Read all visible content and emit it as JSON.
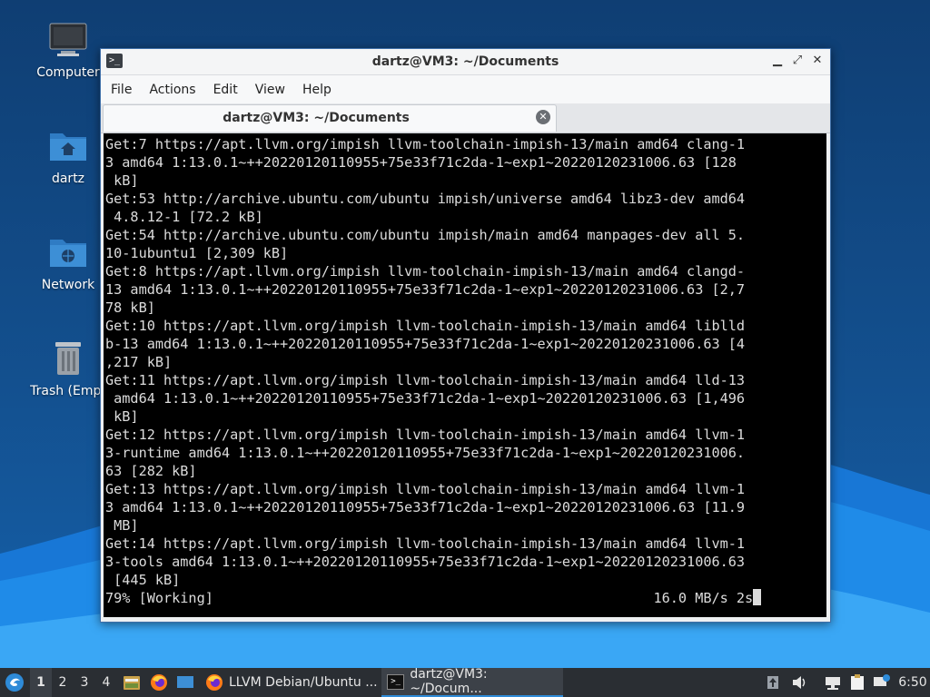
{
  "desktop": {
    "icons": [
      {
        "label": "Computer"
      },
      {
        "label": "dartz"
      },
      {
        "label": "Network"
      },
      {
        "label": "Trash (Empt"
      }
    ]
  },
  "window": {
    "title": "dartz@VM3: ~/Documents",
    "menu": [
      "File",
      "Edit",
      "View",
      "Help",
      "Actions"
    ],
    "menu_items": {
      "file": "File",
      "actions": "Actions",
      "edit": "Edit",
      "view": "View",
      "help": "Help"
    },
    "tab_label": "dartz@VM3: ~/Documents"
  },
  "terminal": {
    "lines": [
      "Get:7 https://apt.llvm.org/impish llvm-toolchain-impish-13/main amd64 clang-1",
      "3 amd64 1:13.0.1~++20220120110955+75e33f71c2da-1~exp1~20220120231006.63 [128",
      " kB]",
      "Get:53 http://archive.ubuntu.com/ubuntu impish/universe amd64 libz3-dev amd64",
      " 4.8.12-1 [72.2 kB]",
      "Get:54 http://archive.ubuntu.com/ubuntu impish/main amd64 manpages-dev all 5.",
      "10-1ubuntu1 [2,309 kB]",
      "Get:8 https://apt.llvm.org/impish llvm-toolchain-impish-13/main amd64 clangd-",
      "13 amd64 1:13.0.1~++20220120110955+75e33f71c2da-1~exp1~20220120231006.63 [2,7",
      "78 kB]",
      "Get:10 https://apt.llvm.org/impish llvm-toolchain-impish-13/main amd64 liblld",
      "b-13 amd64 1:13.0.1~++20220120110955+75e33f71c2da-1~exp1~20220120231006.63 [4",
      ",217 kB]",
      "Get:11 https://apt.llvm.org/impish llvm-toolchain-impish-13/main amd64 lld-13",
      " amd64 1:13.0.1~++20220120110955+75e33f71c2da-1~exp1~20220120231006.63 [1,496",
      " kB]",
      "Get:12 https://apt.llvm.org/impish llvm-toolchain-impish-13/main amd64 llvm-1",
      "3-runtime amd64 1:13.0.1~++20220120110955+75e33f71c2da-1~exp1~20220120231006.",
      "63 [282 kB]",
      "Get:13 https://apt.llvm.org/impish llvm-toolchain-impish-13/main amd64 llvm-1",
      "3 amd64 1:13.0.1~++20220120110955+75e33f71c2da-1~exp1~20220120231006.63 [11.9",
      " MB]",
      "Get:14 https://apt.llvm.org/impish llvm-toolchain-impish-13/main amd64 llvm-1",
      "3-tools amd64 1:13.0.1~++20220120110955+75e33f71c2da-1~exp1~20220120231006.63",
      " [445 kB]"
    ],
    "status_left": "79% [Working]",
    "status_right": "16.0 MB/s 2s"
  },
  "taskbar": {
    "workspaces": [
      "1",
      "2",
      "3",
      "4"
    ],
    "active_workspace": "1",
    "tasks": [
      {
        "label": "LLVM Debian/Ubuntu ..."
      },
      {
        "label": "dartz@VM3: ~/Docum..."
      }
    ],
    "clock": "6:50"
  },
  "colors": {
    "terminal_bg": "#000000",
    "terminal_fg": "#dcdcdc",
    "taskbar_bg": "#2a2e33",
    "accent": "#2e8bd8",
    "folder_blue": "#3d8fd6"
  }
}
